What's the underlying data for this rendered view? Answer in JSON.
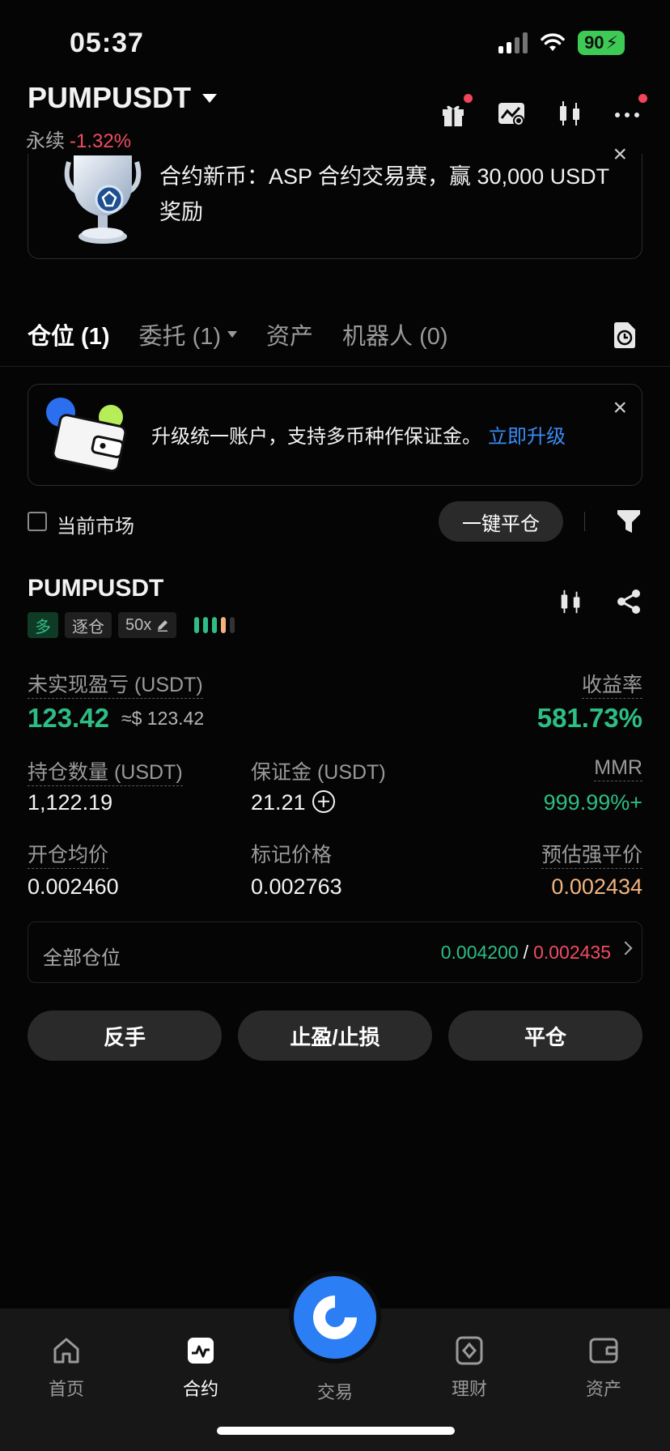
{
  "status_bar": {
    "time": "05:37",
    "battery": "90"
  },
  "header": {
    "pair": "PUMPUSDT",
    "contract_type": "永续",
    "change": "-1.32%"
  },
  "promo": {
    "text": "合约新币：ASP 合约交易赛，赢 30,000 USDT 奖励",
    "close": "×"
  },
  "tabs": [
    {
      "label": "仓位 (1)"
    },
    {
      "label": "委托 (1)"
    },
    {
      "label": "资产"
    },
    {
      "label": "机器人 (0)"
    }
  ],
  "upgrade_banner": {
    "text": "升级统一账户，支持多币种作保证金。",
    "link": "立即升级",
    "close": "×"
  },
  "filter": {
    "current_market_label": "当前市场",
    "close_all_label": "一键平仓"
  },
  "position": {
    "symbol": "PUMPUSDT",
    "side_tag": "多",
    "margin_mode_tag": "逐仓",
    "leverage_tag": "50x",
    "leverage_level": 3,
    "unrealized_pnl_label": "未实现盈亏 (USDT)",
    "unrealized_pnl": "123.42",
    "unrealized_pnl_usd": "≈$ 123.42",
    "roe_label": "收益率",
    "roe": "581.73%",
    "size_label": "持仓数量 (USDT)",
    "size": "1,122.19",
    "margin_label": "保证金 (USDT)",
    "margin": "21.21",
    "mmr_label": "MMR",
    "mmr": "999.99%+",
    "entry_label": "开仓均价",
    "entry": "0.002460",
    "mark_label": "标记价格",
    "mark": "0.002763",
    "liq_label": "预估强平价",
    "liq": "0.002434",
    "tpsl_label": "全部仓位",
    "tp": "0.004200",
    "tpsl_sep": "/",
    "sl": "0.002435"
  },
  "actions": {
    "reverse": "反手",
    "tpsl": "止盈/止损",
    "close": "平仓"
  },
  "bottom_nav": [
    {
      "label": "首页"
    },
    {
      "label": "合约"
    },
    {
      "label": "交易"
    },
    {
      "label": "理财"
    },
    {
      "label": "资产"
    }
  ],
  "colors": {
    "green": "#2ebd85",
    "red": "#ef4d62",
    "orange": "#f2b47f",
    "blue": "#2b7ef4"
  }
}
